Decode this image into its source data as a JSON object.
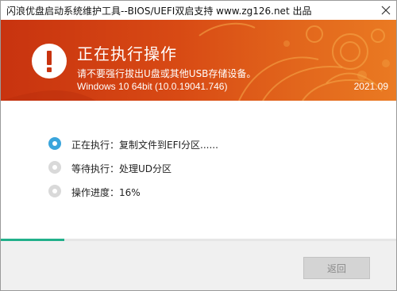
{
  "window": {
    "title": "闪浪优盘启动系统维护工具--BIOS/UEFI双启支持 www.zg126.net 出品"
  },
  "banner": {
    "headline": "正在执行操作",
    "warning": "请不要强行拔出U盘或其他USB存储设备。",
    "version": "Windows 10 64bit (10.0.19041.746)",
    "date": "2021.09",
    "colors": {
      "start": "#c8330f",
      "end": "#ea7a22"
    }
  },
  "steps": [
    {
      "text": "正在执行：复制文件到EFI分区......",
      "state": "active"
    },
    {
      "text": "等待执行：处理UD分区",
      "state": "pending"
    },
    {
      "text": "操作进度：16%",
      "state": "pending"
    }
  ],
  "progress": {
    "percent": 16,
    "color": "#21b08a"
  },
  "footer": {
    "back_label": "返回"
  },
  "icons": {
    "close": "close-icon",
    "warning": "exclamation-icon"
  }
}
